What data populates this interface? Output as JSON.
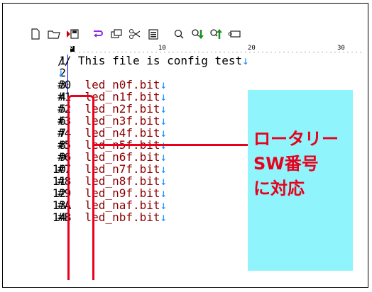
{
  "toolbar": {
    "icons": [
      "new-file-icon",
      "open-folder-icon",
      "save-icon",
      "undo-icon",
      "copy-icon",
      "cut-icon",
      "paste-icon",
      "search-icon",
      "search-down-icon",
      "search-up-icon",
      "replace-icon"
    ]
  },
  "ruler": {
    "labels": [
      "0",
      "10",
      "20",
      "30"
    ]
  },
  "lines": [
    {
      "num": "1",
      "text": "// This file is config test",
      "kind": "comment"
    },
    {
      "num": "2",
      "text": "",
      "kind": "empty"
    },
    {
      "num": "3",
      "hash": "#0",
      "text": "  led_n0f.bit"
    },
    {
      "num": "4",
      "hash": "#1",
      "text": "  led_n1f.bit"
    },
    {
      "num": "5",
      "hash": "#2",
      "text": "  led_n2f.bit"
    },
    {
      "num": "6",
      "hash": "#3",
      "text": "  led_n3f.bit"
    },
    {
      "num": "7",
      "hash": "#4",
      "text": "  led_n4f.bit"
    },
    {
      "num": "8",
      "hash": "#5",
      "text": "  led_n5f.bit"
    },
    {
      "num": "9",
      "hash": "#6",
      "text": "  led_n6f.bit"
    },
    {
      "num": "10",
      "hash": "#7",
      "text": "  led_n7f.bit"
    },
    {
      "num": "11",
      "hash": "#8",
      "text": "  led_n8f.bit"
    },
    {
      "num": "12",
      "hash": "#9",
      "text": "  led_n9f.bit"
    },
    {
      "num": "13",
      "hash": "#A",
      "text": "  led_naf.bit"
    },
    {
      "num": "14",
      "hash": "#B",
      "text": "  led_nbf.bit"
    }
  ],
  "eol_symbol": "↓",
  "callout": {
    "line1": "ロータリー",
    "line2": "SW番号",
    "line3": "に対応"
  },
  "colors": {
    "accent_red": "#e8001c",
    "code_text": "#8b0000",
    "eol_marker": "#1e90ff",
    "callout_bg": "#8ff4fb"
  }
}
